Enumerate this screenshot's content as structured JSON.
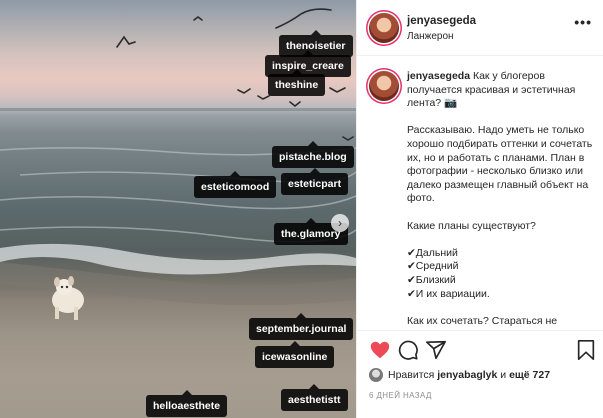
{
  "header": {
    "username": "jenyasegeda",
    "location": "Ланжерон",
    "more_glyph": "•••"
  },
  "caption": {
    "username": "jenyasegeda",
    "paragraphs": [
      "Как у блогеров получается красивая и эстетичная лента? 📷",
      "Рассказываю. Надо уметь не только хорошо подбирать оттенки и сочетать их, но и работать с планами. План в фотографии - несколько близко или далеко размещен главный объект на фото.",
      "Какие планы существуют?",
      "✔Дальний\n✔Средний\n✔Близкий\n✔И их вариации.",
      "Как их сочетать? Стараться не"
    ]
  },
  "tags": [
    "thenoisetier",
    "inspire_creare",
    "theshine",
    "pistache.blog",
    "esteticomood",
    "esteticpart",
    "the.glamory",
    "september.journal",
    "icewasonline",
    "helloaesthete",
    "aesthetistt"
  ],
  "actions": {
    "icons": [
      "heart-icon",
      "comment-icon",
      "share-icon",
      "bookmark-icon"
    ],
    "liked_color": "#ed4956"
  },
  "likes": {
    "prefix": "Нравится ",
    "user": "jenyabaglyk",
    "middle": " и ",
    "others": "ещё 727"
  },
  "timestamp": "6 ДНЕЙ НАЗАД"
}
